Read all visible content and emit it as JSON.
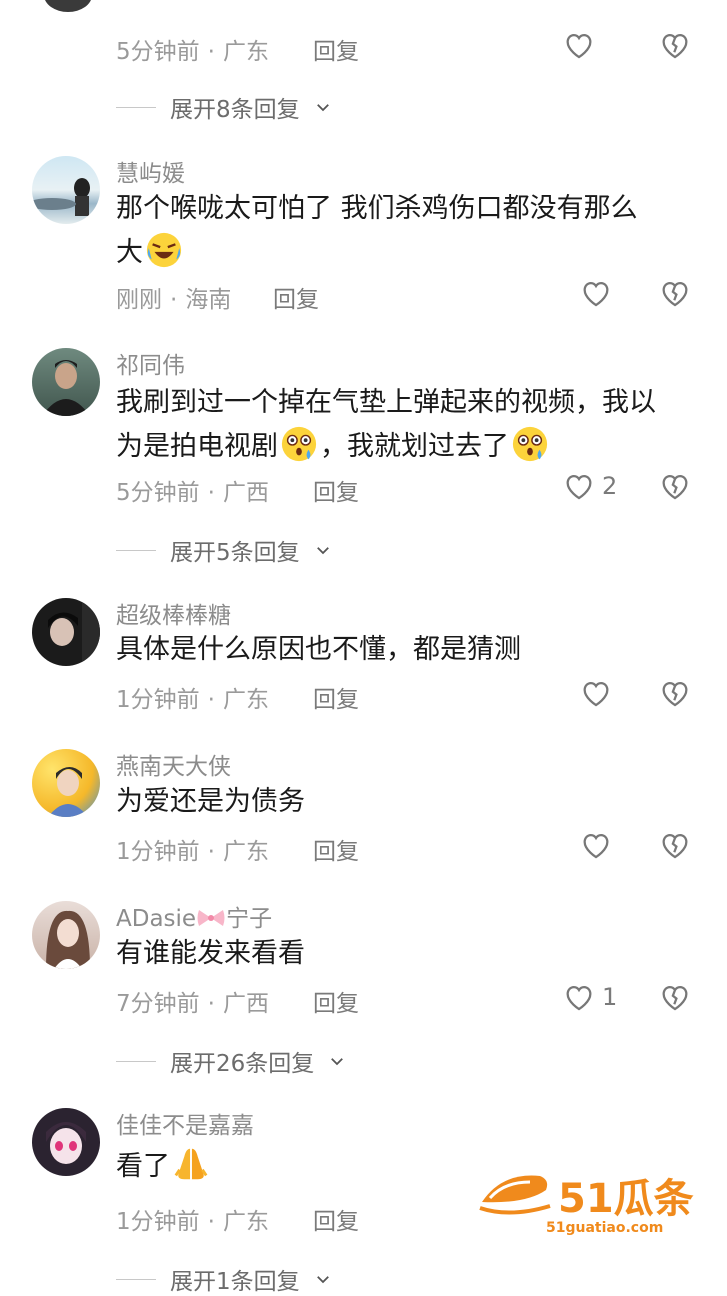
{
  "top_partial": {
    "meta": {
      "time": "5分钟前",
      "location": "广东",
      "reply": "回复"
    },
    "expand": "展开8条回复"
  },
  "comments": [
    {
      "username": "慧屿媛",
      "text_1": "那个喉咙太可怕了  我们杀鸡伤口都没有那么",
      "text_2": "大",
      "time": "刚刚",
      "location": "海南",
      "reply": "回复",
      "likes": ""
    },
    {
      "username": "祁同伟",
      "text_1": "我刷到过一个掉在气垫上弹起来的视频，我以",
      "text_2a": "为是拍电视剧",
      "text_2b": "，我就划过去了",
      "time": "5分钟前",
      "location": "广西",
      "reply": "回复",
      "likes": "2",
      "expand": "展开5条回复"
    },
    {
      "username": "超级棒棒糖",
      "text": "具体是什么原因也不懂，都是猜测",
      "time": "1分钟前",
      "location": "广东",
      "reply": "回复",
      "likes": ""
    },
    {
      "username": "燕南天大侠",
      "text": "为爱还是为债务",
      "time": "1分钟前",
      "location": "广东",
      "reply": "回复",
      "likes": ""
    },
    {
      "username_a": "ADasie",
      "username_b": "宁子",
      "text": "有谁能发来看看",
      "time": "7分钟前",
      "location": "广西",
      "reply": "回复",
      "likes": "1",
      "expand": "展开26条回复"
    },
    {
      "username": "佳佳不是嘉嘉",
      "text": "看了",
      "time": "1分钟前",
      "location": "广东",
      "reply": "回复",
      "likes": "",
      "expand": "展开1条回复"
    }
  ],
  "watermark": {
    "brand": "51瓜条",
    "url": "51guatiao.com",
    "color": "#f08a1c"
  }
}
